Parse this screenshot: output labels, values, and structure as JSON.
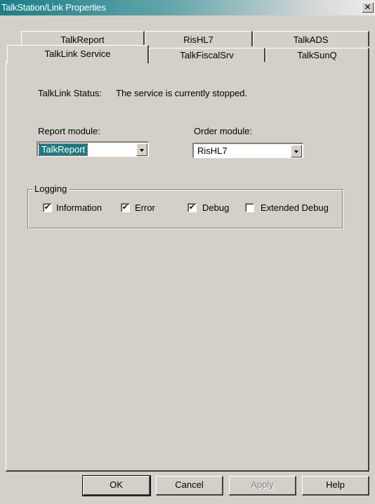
{
  "window": {
    "title": "TalkStation/Link Properties",
    "close_glyph": "✕"
  },
  "tabs": {
    "back_row": [
      "TalkReport",
      "RisHL7",
      "TalkADS"
    ],
    "front_row": [
      "TalkLink Service",
      "TalkFiscalSrv",
      "TalkSunQ"
    ],
    "active": "TalkLink Service"
  },
  "status": {
    "label": "TalkLink Status:",
    "value": "The service is currently stopped."
  },
  "report_module": {
    "label": "Report module:",
    "value": "TalkReport"
  },
  "order_module": {
    "label": "Order module:",
    "value": "RisHL7"
  },
  "logging": {
    "title": "Logging",
    "options": [
      {
        "label": "Information",
        "checked": true
      },
      {
        "label": "Error",
        "checked": true
      },
      {
        "label": "Debug",
        "checked": true
      },
      {
        "label": "Extended Debug",
        "checked": false
      }
    ],
    "check_glyph": "✔"
  },
  "buttons": {
    "ok": "OK",
    "cancel": "Cancel",
    "apply": "Apply",
    "help": "Help"
  },
  "colors": {
    "title_bar": "#1b7f87",
    "dialog_bg": "#d4d0c8",
    "selection": "#1d7a80"
  }
}
